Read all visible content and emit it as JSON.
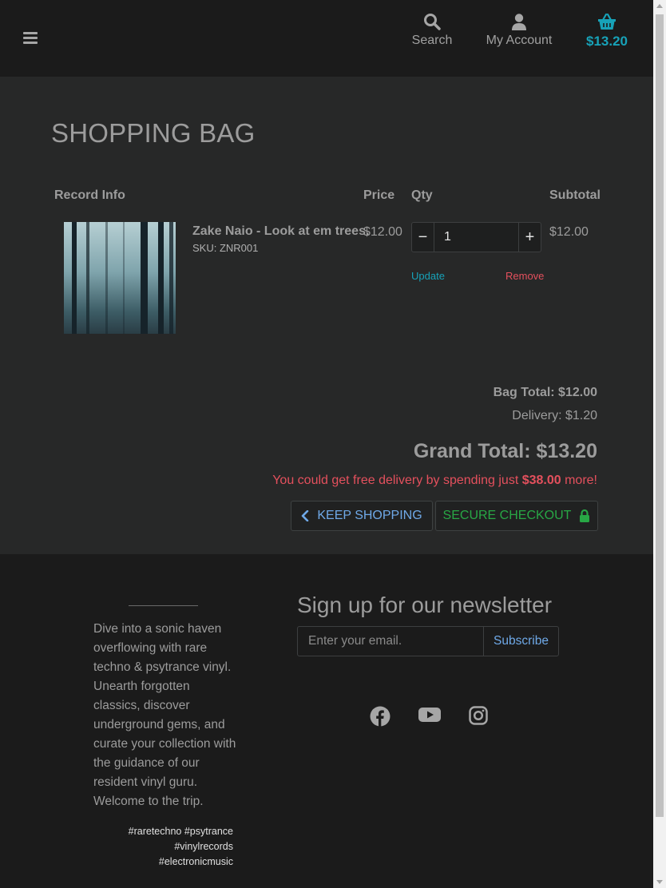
{
  "header": {
    "search_label": "Search",
    "account_label": "My Account",
    "cart_total": "$13.20"
  },
  "bag": {
    "title": "SHOPPING BAG",
    "columns": {
      "info": "Record Info",
      "price": "Price",
      "qty": "Qty",
      "subtotal": "Subtotal"
    },
    "items": [
      {
        "name": "Zake Naio - Look at em trees.",
        "sku": "SKU: ZNR001",
        "price": "$12.00",
        "qty": "1",
        "subtotal": "$12.00",
        "update_label": "Update",
        "remove_label": "Remove"
      }
    ],
    "bag_total": "Bag Total: $12.00",
    "delivery": "Delivery: $1.20",
    "grand_total": "Grand Total: $13.20",
    "free_delivery_prefix": "You could get free delivery by spending just ",
    "free_delivery_amount": "$38.00",
    "free_delivery_suffix": " more!",
    "keep_shopping_label": "KEEP SHOPPING",
    "secure_checkout_label": "SECURE CHECKOUT"
  },
  "footer": {
    "about": "Dive into a sonic haven overflowing with rare techno & psytrance vinyl. Unearth forgotten classics, discover underground gems, and curate your collection with the guidance of our resident vinyl guru. Welcome to the trip.",
    "tags": [
      "#raretechno #psytrance",
      "#vinylrecords",
      "#electronicmusic"
    ],
    "newsletter_title": "Sign up for our newsletter",
    "email_placeholder": "Enter your email.",
    "subscribe_label": "Subscribe",
    "social": [
      "facebook-icon",
      "youtube-icon",
      "instagram-icon"
    ]
  },
  "colors": {
    "accent": "#17a2b8",
    "danger": "#e4505d",
    "success": "#28a745",
    "link": "#6fa9e8"
  }
}
